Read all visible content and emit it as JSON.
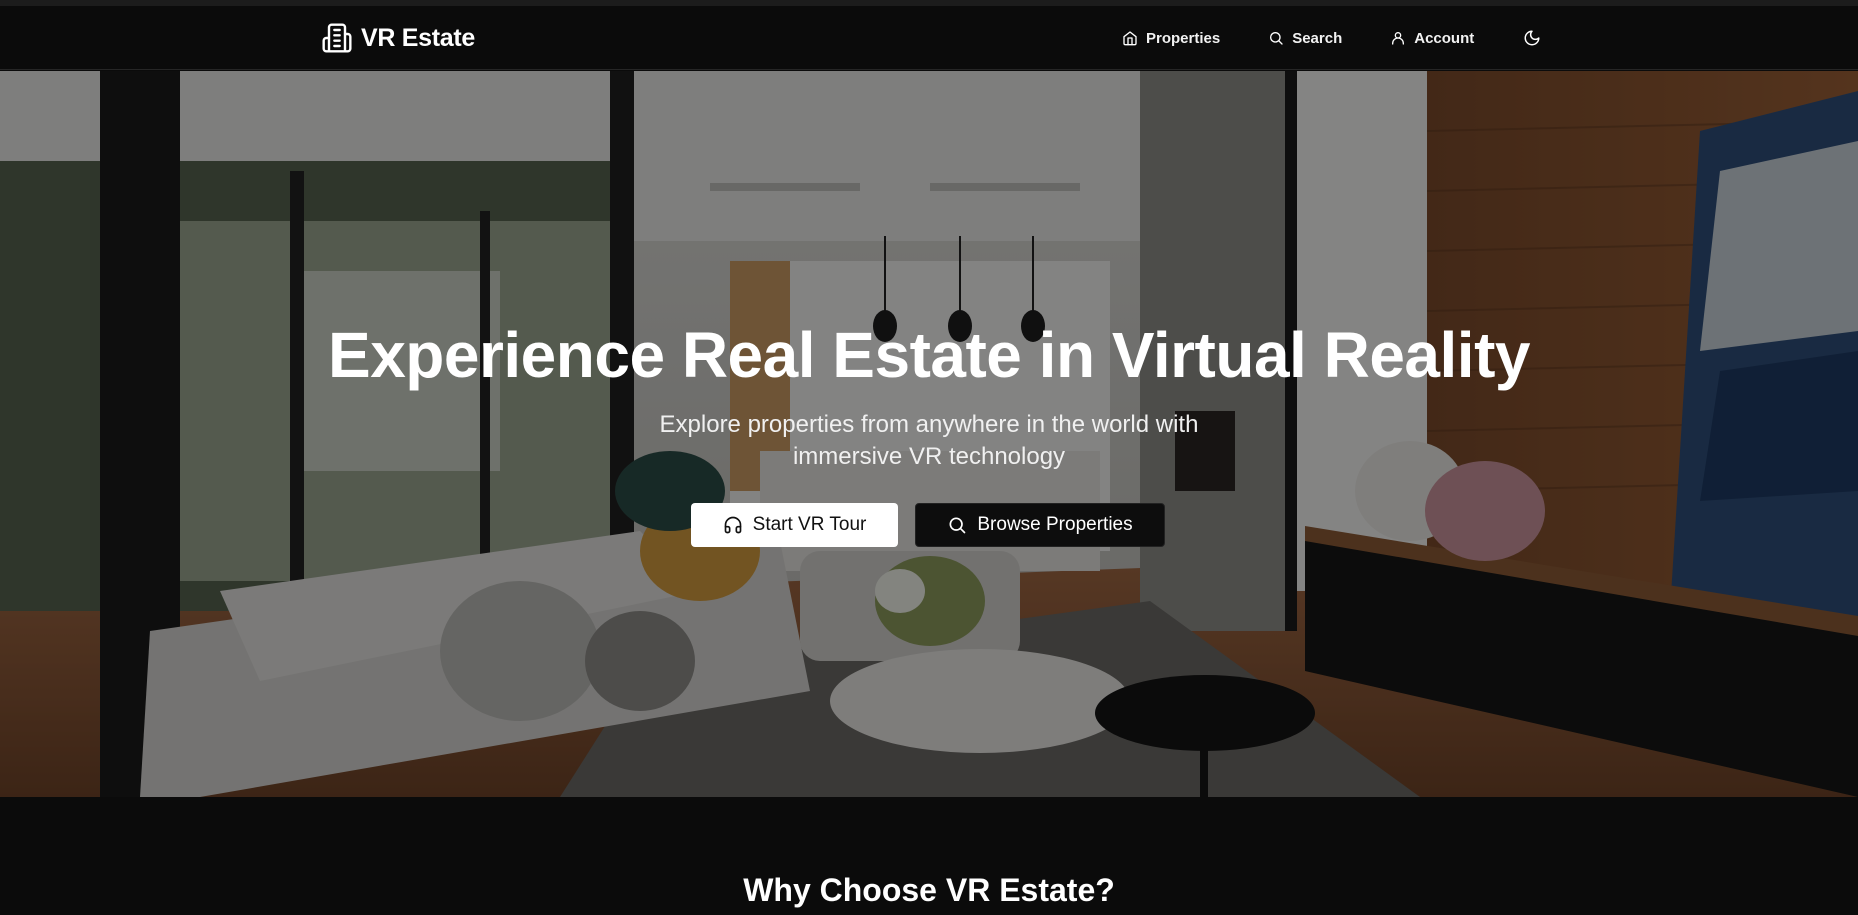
{
  "brand": {
    "name": "VR Estate",
    "icon": "building-icon"
  },
  "nav": {
    "items": [
      {
        "label": "Properties",
        "icon": "home-icon"
      },
      {
        "label": "Search",
        "icon": "search-icon"
      },
      {
        "label": "Account",
        "icon": "user-icon"
      }
    ],
    "theme_icon": "moon-icon"
  },
  "hero": {
    "title": "Experience Real Estate in Virtual Reality",
    "subtitle": "Explore properties from anywhere in the world with immersive VR technology",
    "primary_label": "Start VR Tour",
    "secondary_label": "Browse Properties"
  },
  "section": {
    "title": "Why Choose VR Estate?"
  },
  "colors": {
    "background": "#0b0b0b",
    "primary_button": "#ffffff",
    "secondary_button": "#0d0d0d"
  }
}
